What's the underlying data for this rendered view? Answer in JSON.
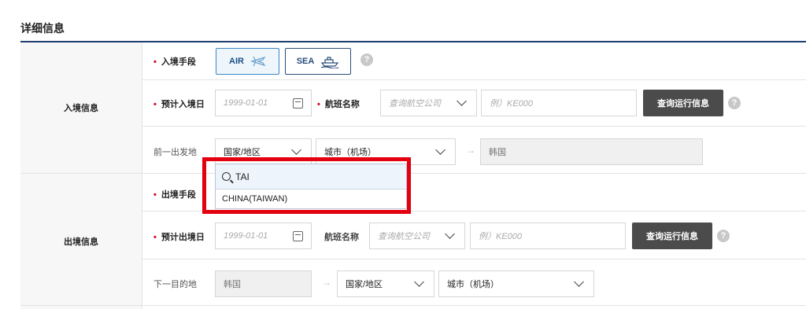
{
  "section": {
    "title": "详细信息"
  },
  "entry": {
    "group_label": "入境信息",
    "method_label": "入境手段",
    "air_label": "AIR",
    "sea_label": "SEA",
    "date_label": "预计入境日",
    "date_placeholder": "1999-01-01",
    "flight_label": "航班名称",
    "airline_placeholder": "查询航空公司",
    "flight_no_placeholder": "例）KE000",
    "query_button": "查询运行信息",
    "origin_label": "前一出发地",
    "country_select": "国家/地区",
    "city_select": "城市（机场）",
    "destination": "韩国"
  },
  "exit": {
    "group_label": "出境信息",
    "method_label": "出境手段",
    "date_label": "预计出境日",
    "date_placeholder": "1999-01-01",
    "flight_label": "航班名称",
    "airline_placeholder": "查询航空公司",
    "flight_no_placeholder": "例）KE000",
    "query_button": "查询运行信息",
    "next_label": "下一目的地",
    "origin": "韩国",
    "country_select": "国家/地区",
    "city_select": "城市（机场）"
  },
  "dropdown": {
    "search_value": "TAI",
    "options": [
      "CHINA(TAIWAN)"
    ]
  },
  "colors": {
    "accent": "#1f3e70",
    "highlight": "#e3000f",
    "required": "#d0021b"
  },
  "icons": {
    "help": "?",
    "arrow": "→"
  }
}
